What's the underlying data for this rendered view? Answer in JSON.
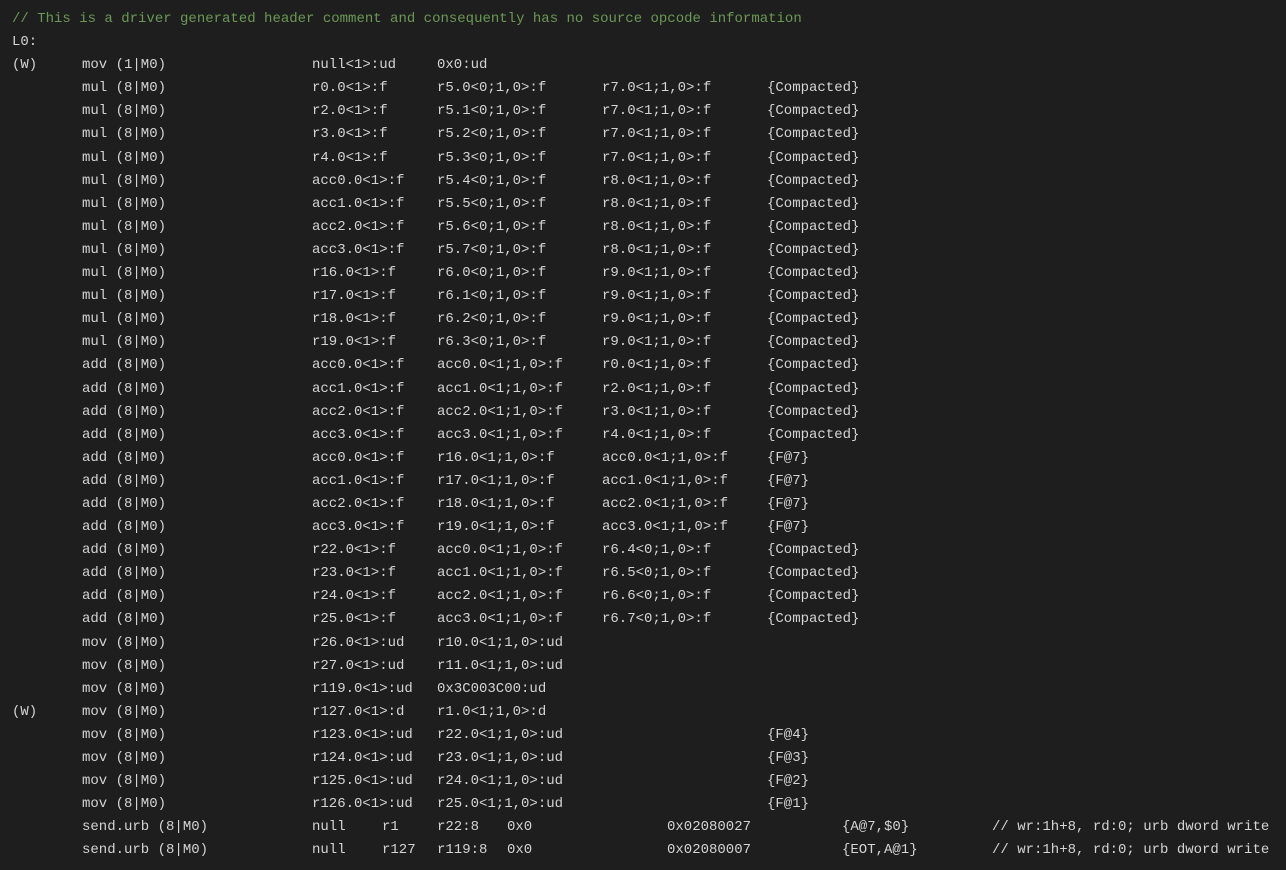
{
  "comment": "// This is a driver generated header comment and consequently has no source opcode information",
  "label": "L0:",
  "rows": [
    {
      "pred": "(W)",
      "op": "mov (1|M0)",
      "dst": "null<1>:ud",
      "s0": "0x0:ud",
      "s1": "",
      "flags": ""
    },
    {
      "pred": "",
      "op": "mul (8|M0)",
      "dst": "r0.0<1>:f",
      "s0": "r5.0<0;1,0>:f",
      "s1": "r7.0<1;1,0>:f",
      "flags": "{Compacted}"
    },
    {
      "pred": "",
      "op": "mul (8|M0)",
      "dst": "r2.0<1>:f",
      "s0": "r5.1<0;1,0>:f",
      "s1": "r7.0<1;1,0>:f",
      "flags": "{Compacted}"
    },
    {
      "pred": "",
      "op": "mul (8|M0)",
      "dst": "r3.0<1>:f",
      "s0": "r5.2<0;1,0>:f",
      "s1": "r7.0<1;1,0>:f",
      "flags": "{Compacted}"
    },
    {
      "pred": "",
      "op": "mul (8|M0)",
      "dst": "r4.0<1>:f",
      "s0": "r5.3<0;1,0>:f",
      "s1": "r7.0<1;1,0>:f",
      "flags": "{Compacted}"
    },
    {
      "pred": "",
      "op": "mul (8|M0)",
      "dst": "acc0.0<1>:f",
      "s0": "r5.4<0;1,0>:f",
      "s1": "r8.0<1;1,0>:f",
      "flags": "{Compacted}"
    },
    {
      "pred": "",
      "op": "mul (8|M0)",
      "dst": "acc1.0<1>:f",
      "s0": "r5.5<0;1,0>:f",
      "s1": "r8.0<1;1,0>:f",
      "flags": "{Compacted}"
    },
    {
      "pred": "",
      "op": "mul (8|M0)",
      "dst": "acc2.0<1>:f",
      "s0": "r5.6<0;1,0>:f",
      "s1": "r8.0<1;1,0>:f",
      "flags": "{Compacted}"
    },
    {
      "pred": "",
      "op": "mul (8|M0)",
      "dst": "acc3.0<1>:f",
      "s0": "r5.7<0;1,0>:f",
      "s1": "r8.0<1;1,0>:f",
      "flags": "{Compacted}"
    },
    {
      "pred": "",
      "op": "mul (8|M0)",
      "dst": "r16.0<1>:f",
      "s0": "r6.0<0;1,0>:f",
      "s1": "r9.0<1;1,0>:f",
      "flags": "{Compacted}"
    },
    {
      "pred": "",
      "op": "mul (8|M0)",
      "dst": "r17.0<1>:f",
      "s0": "r6.1<0;1,0>:f",
      "s1": "r9.0<1;1,0>:f",
      "flags": "{Compacted}"
    },
    {
      "pred": "",
      "op": "mul (8|M0)",
      "dst": "r18.0<1>:f",
      "s0": "r6.2<0;1,0>:f",
      "s1": "r9.0<1;1,0>:f",
      "flags": "{Compacted}"
    },
    {
      "pred": "",
      "op": "mul (8|M0)",
      "dst": "r19.0<1>:f",
      "s0": "r6.3<0;1,0>:f",
      "s1": "r9.0<1;1,0>:f",
      "flags": "{Compacted}"
    },
    {
      "pred": "",
      "op": "add (8|M0)",
      "dst": "acc0.0<1>:f",
      "s0": "acc0.0<1;1,0>:f",
      "s1": "r0.0<1;1,0>:f",
      "flags": "{Compacted}"
    },
    {
      "pred": "",
      "op": "add (8|M0)",
      "dst": "acc1.0<1>:f",
      "s0": "acc1.0<1;1,0>:f",
      "s1": "r2.0<1;1,0>:f",
      "flags": "{Compacted}"
    },
    {
      "pred": "",
      "op": "add (8|M0)",
      "dst": "acc2.0<1>:f",
      "s0": "acc2.0<1;1,0>:f",
      "s1": "r3.0<1;1,0>:f",
      "flags": "{Compacted}"
    },
    {
      "pred": "",
      "op": "add (8|M0)",
      "dst": "acc3.0<1>:f",
      "s0": "acc3.0<1;1,0>:f",
      "s1": "r4.0<1;1,0>:f",
      "flags": "{Compacted}"
    },
    {
      "pred": "",
      "op": "add (8|M0)",
      "dst": "acc0.0<1>:f",
      "s0": "r16.0<1;1,0>:f",
      "s1": "acc0.0<1;1,0>:f",
      "flags": "{F@7}"
    },
    {
      "pred": "",
      "op": "add (8|M0)",
      "dst": "acc1.0<1>:f",
      "s0": "r17.0<1;1,0>:f",
      "s1": "acc1.0<1;1,0>:f",
      "flags": "{F@7}"
    },
    {
      "pred": "",
      "op": "add (8|M0)",
      "dst": "acc2.0<1>:f",
      "s0": "r18.0<1;1,0>:f",
      "s1": "acc2.0<1;1,0>:f",
      "flags": "{F@7}"
    },
    {
      "pred": "",
      "op": "add (8|M0)",
      "dst": "acc3.0<1>:f",
      "s0": "r19.0<1;1,0>:f",
      "s1": "acc3.0<1;1,0>:f",
      "flags": "{F@7}"
    },
    {
      "pred": "",
      "op": "add (8|M0)",
      "dst": "r22.0<1>:f",
      "s0": "acc0.0<1;1,0>:f",
      "s1": "r6.4<0;1,0>:f",
      "flags": "{Compacted}"
    },
    {
      "pred": "",
      "op": "add (8|M0)",
      "dst": "r23.0<1>:f",
      "s0": "acc1.0<1;1,0>:f",
      "s1": "r6.5<0;1,0>:f",
      "flags": "{Compacted}"
    },
    {
      "pred": "",
      "op": "add (8|M0)",
      "dst": "r24.0<1>:f",
      "s0": "acc2.0<1;1,0>:f",
      "s1": "r6.6<0;1,0>:f",
      "flags": "{Compacted}"
    },
    {
      "pred": "",
      "op": "add (8|M0)",
      "dst": "r25.0<1>:f",
      "s0": "acc3.0<1;1,0>:f",
      "s1": "r6.7<0;1,0>:f",
      "flags": "{Compacted}"
    },
    {
      "pred": "",
      "op": "mov (8|M0)",
      "dst": "r26.0<1>:ud",
      "s0": "r10.0<1;1,0>:ud",
      "s1": "",
      "flags": ""
    },
    {
      "pred": "",
      "op": "mov (8|M0)",
      "dst": "r27.0<1>:ud",
      "s0": "r11.0<1;1,0>:ud",
      "s1": "",
      "flags": ""
    },
    {
      "pred": "",
      "op": "mov (8|M0)",
      "dst": "r119.0<1>:ud",
      "s0": "0x3C003C00:ud",
      "s1": "",
      "flags": ""
    },
    {
      "pred": "(W)",
      "op": "mov (8|M0)",
      "dst": "r127.0<1>:d",
      "s0": "r1.0<1;1,0>:d",
      "s1": "",
      "flags": ""
    },
    {
      "pred": "",
      "op": "mov (8|M0)",
      "dst": "r123.0<1>:ud",
      "s0": "r22.0<1;1,0>:ud",
      "s1": "",
      "flags": "{F@4}"
    },
    {
      "pred": "",
      "op": "mov (8|M0)",
      "dst": "r124.0<1>:ud",
      "s0": "r23.0<1;1,0>:ud",
      "s1": "",
      "flags": "{F@3}"
    },
    {
      "pred": "",
      "op": "mov (8|M0)",
      "dst": "r125.0<1>:ud",
      "s0": "r24.0<1;1,0>:ud",
      "s1": "",
      "flags": "{F@2}"
    },
    {
      "pred": "",
      "op": "mov (8|M0)",
      "dst": "r126.0<1>:ud",
      "s0": "r25.0<1;1,0>:ud",
      "s1": "",
      "flags": "{F@1}"
    }
  ],
  "sends": [
    {
      "pred": "",
      "op": "send.urb (8|M0)",
      "a": "null",
      "b": "r1",
      "c": "r22:8",
      "d": "0x0",
      "ex": "0x02080027",
      "fl": "{A@7,$0}",
      "cmt": "// wr:1h+8, rd:0; urb dword write"
    },
    {
      "pred": "",
      "op": "send.urb (8|M0)",
      "a": "null",
      "b": "r127",
      "c": "r119:8",
      "d": "0x0",
      "ex": "0x02080007",
      "fl": "{EOT,A@1}",
      "cmt": "// wr:1h+8, rd:0; urb dword write"
    }
  ]
}
